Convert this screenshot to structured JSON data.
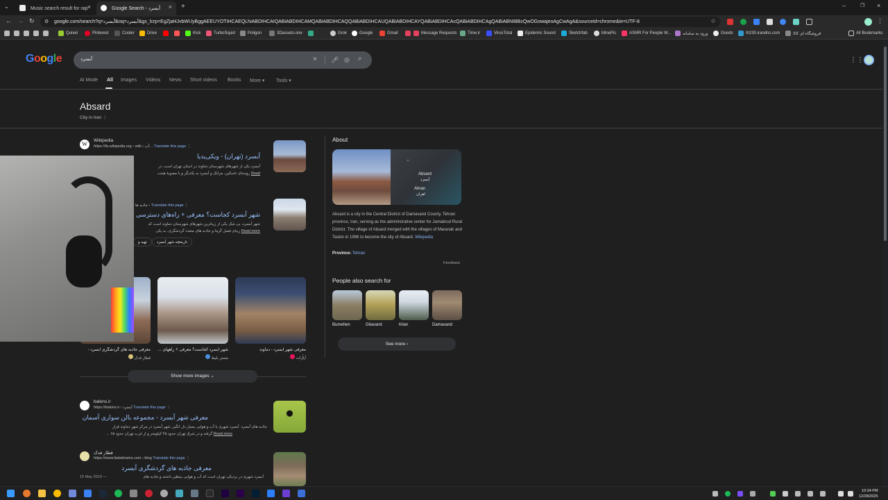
{
  "browser": {
    "tabs": [
      {
        "title": "Music search result for rap",
        "active": false
      },
      {
        "title": "Google Search - آبسرد",
        "active": true
      }
    ],
    "new_tab": "+",
    "url": "google.com/search?q=آبسرد&oq=آبسرد&gs_lcrp=EgZjaHJvbWUyBggAEEUYOTIHCAEQLhiABDIHCAIQABiABDIHCAMQABiABDIHCAQQABiABDIHCAUQABiABDIHCAYQABiABDIHCAcQABiABDIHCAgQABiABNIBBzQwOGowajeoAgCwAgA&sourceid=chrome&ie=UTF-8",
    "bookmarks": [
      "Quixel",
      "Pinterest",
      "Cooler",
      "Drive",
      "Kick",
      "TurboSquid",
      "Poligon",
      "3Dassets.one",
      "Grok",
      "Google",
      "Gmail",
      "Message Requests",
      "Time.ir",
      "VirusTotal",
      "Epidemic Sound",
      "Sketchfab",
      "MinePic",
      "ASMR For People W...",
      "ورود به سامانه",
      "Goods",
      "Ih230.irandns.com",
      "فروشگاه ای کالا"
    ],
    "all_bookmarks": "All Bookmarks"
  },
  "google": {
    "logo": "Google",
    "query": "آبسرد",
    "tabs": [
      "AI Mode",
      "All",
      "Images",
      "Videos",
      "News",
      "Short videos",
      "Books",
      "More",
      "Tools"
    ],
    "active_tab": "All"
  },
  "kp_header": {
    "title": "Absard",
    "subtitle": "City in Iran"
  },
  "results": [
    {
      "site": "Wikipedia",
      "url": "https://fa.wikipedia.org › wiki › آب...",
      "translate": "Translate this page",
      "title": "آبسرد (تهران) - ویکی‌پدیا",
      "snippet1": "آبسرد یکی از شهرهای شهرستان دماوند در استان تهران است. در",
      "snippet2": "روستای تاسکین، مرانک و آبسرد به یکدیگر و با مصوبهٔ هیئت",
      "read": "Read"
    },
    {
      "site": "جاذبه ها",
      "url": "جاذبه ها ›",
      "translate": "Translate this page",
      "title": "شهر آبسرد کجاست؟ معرفی + راه‌های دسترسی",
      "snippet1": "شهر آبسرد، بی شک یکی از زیباترین شهرهای شهرستان دماوند است که",
      "snippet2": "زیبای فصل گرما و جاذبه های متعدد گردشگری، به یکی",
      "read": "Read more",
      "chips": [
        "تاریخچه شهر آبسرد",
        "تهیه و"
      ]
    }
  ],
  "images_row": [
    {
      "caption": "معرفی جاذبه های گردشگری آبسرد -",
      "source": "قطار فدک"
    },
    {
      "caption": "شهر آبسرد کجاست؟ معرفی + راههای ...",
      "source": "مستر بلیط"
    },
    {
      "caption": "معرفی شهر آبسرد - دماوند",
      "source": "آپارات"
    }
  ],
  "show_more_images": "Show more images",
  "results2": [
    {
      "site": "balons.ir",
      "url": "https://balons.ir › آبسرد",
      "translate": "Translate this page",
      "title": "معرفی شهر آبسرد - مجموعه بالن سواری آسمان",
      "snippet1": "جاذبه های آبسرد. آبسرد شهری با آب و هوایی بسیار دل انگیز. شهر آبسرد در مرکز شهر دماوند قرار",
      "snippet2": "گرفته و در شرق تهران حدود ۴۵ کیلومتر و از غرب تهران حدود ۶۵ ...",
      "read": "Read more"
    },
    {
      "site": "قطار فدک",
      "url": "https://www.fadaktrains.com › blog",
      "translate": "Translate this page",
      "title": "معرفی جاذبه های گردشگری آبسرد",
      "date": "15 May 2019 —",
      "snippet1": "آبسرد شهری در نزدیکی تهران است که آب و هوایی بینظیر داشته و جاذبه های"
    }
  ],
  "knowledge_panel": {
    "about": "About",
    "map_label_1": "Absard",
    "map_label_1_fa": "آبسرد",
    "map_label_2": "Ahran",
    "map_label_2_fa": "اهران",
    "description": "Absard is a city in the Central District of Damavand County, Tehran province, Iran, serving as the administrative center for Jamabrud Rural District. The village of Absard merged with the villages of Maranak and Taskin in 1996 to become the city of Absard.",
    "wiki_link": "Wikipedia",
    "province_label": "Province:",
    "province_value": "Tehran",
    "feedback": "Feedback",
    "people_also_search": "People also search for",
    "pas": [
      "Bumehen",
      "Gilavand",
      "Kilan",
      "Damavand"
    ],
    "see_more": "See more"
  },
  "taskbar": {
    "time": "10:34 PM",
    "date": "12/28/2025"
  }
}
